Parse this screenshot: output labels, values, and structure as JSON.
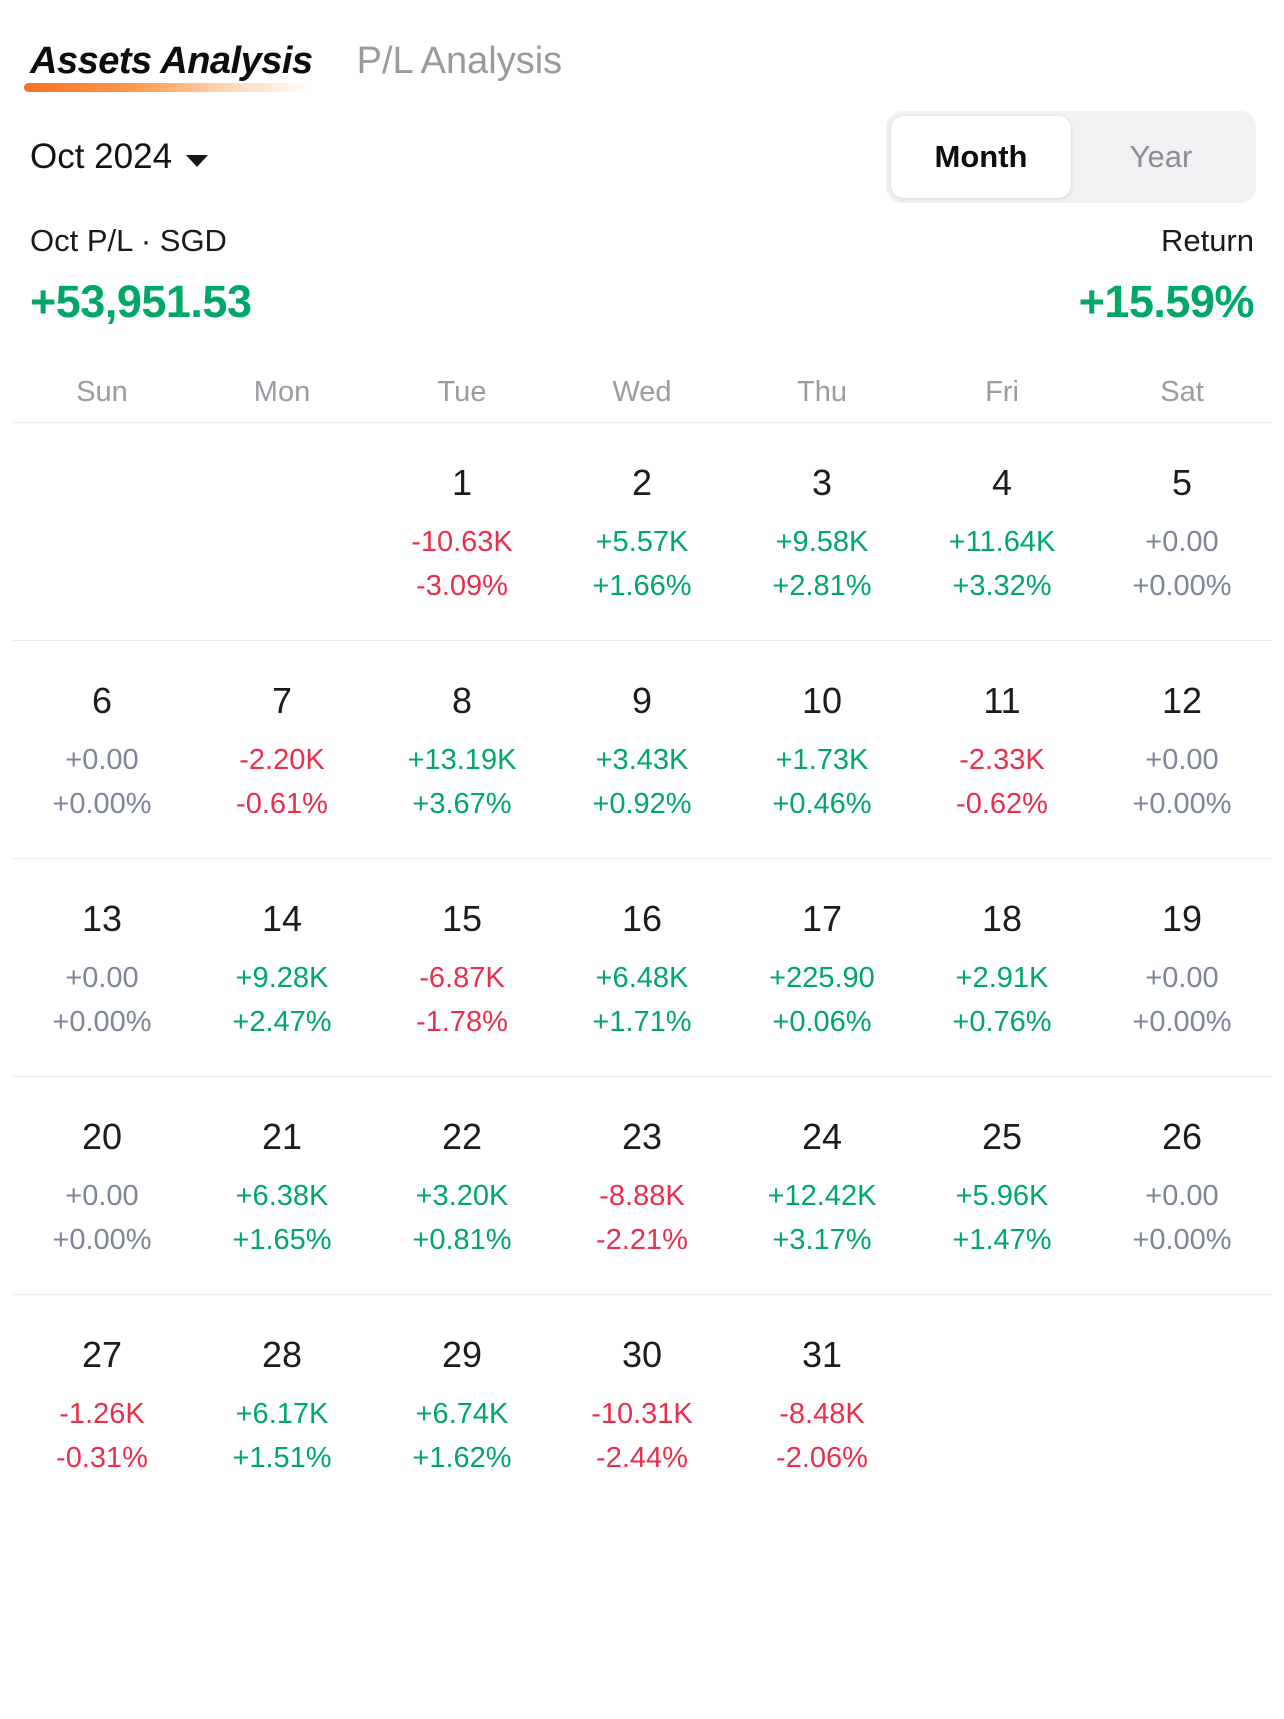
{
  "tabs": [
    {
      "label": "Assets Analysis",
      "active": true
    },
    {
      "label": "P/L Analysis",
      "active": false
    }
  ],
  "period_selector": {
    "label": "Oct 2024",
    "caret_icon": "chevron-down-icon"
  },
  "range_toggle": {
    "options": [
      {
        "label": "Month",
        "active": true
      },
      {
        "label": "Year",
        "active": false
      }
    ]
  },
  "summary": {
    "pl_label": "Oct P/L · SGD",
    "pl_value": "+53,951.53",
    "pl_state": "pos",
    "return_label": "Return",
    "return_value": "+15.59%",
    "return_state": "pos"
  },
  "colors": {
    "positive": "#00a868",
    "negative": "#eb2f4b",
    "zero": "#7d8697",
    "accent": "#f77122",
    "text": "#1c1c20",
    "muted": "#9b9ba2"
  },
  "calendar": {
    "weekdays": [
      "Sun",
      "Mon",
      "Tue",
      "Wed",
      "Thu",
      "Fri",
      "Sat"
    ],
    "weeks": [
      [
        {
          "empty": true
        },
        {
          "empty": true
        },
        {
          "day": "1",
          "amount": "-10.63K",
          "percent": "-3.09%",
          "state": "neg"
        },
        {
          "day": "2",
          "amount": "+5.57K",
          "percent": "+1.66%",
          "state": "pos"
        },
        {
          "day": "3",
          "amount": "+9.58K",
          "percent": "+2.81%",
          "state": "pos"
        },
        {
          "day": "4",
          "amount": "+11.64K",
          "percent": "+3.32%",
          "state": "pos"
        },
        {
          "day": "5",
          "amount": "+0.00",
          "percent": "+0.00%",
          "state": "zero"
        }
      ],
      [
        {
          "day": "6",
          "amount": "+0.00",
          "percent": "+0.00%",
          "state": "zero"
        },
        {
          "day": "7",
          "amount": "-2.20K",
          "percent": "-0.61%",
          "state": "neg"
        },
        {
          "day": "8",
          "amount": "+13.19K",
          "percent": "+3.67%",
          "state": "pos"
        },
        {
          "day": "9",
          "amount": "+3.43K",
          "percent": "+0.92%",
          "state": "pos"
        },
        {
          "day": "10",
          "amount": "+1.73K",
          "percent": "+0.46%",
          "state": "pos"
        },
        {
          "day": "11",
          "amount": "-2.33K",
          "percent": "-0.62%",
          "state": "neg"
        },
        {
          "day": "12",
          "amount": "+0.00",
          "percent": "+0.00%",
          "state": "zero"
        }
      ],
      [
        {
          "day": "13",
          "amount": "+0.00",
          "percent": "+0.00%",
          "state": "zero"
        },
        {
          "day": "14",
          "amount": "+9.28K",
          "percent": "+2.47%",
          "state": "pos"
        },
        {
          "day": "15",
          "amount": "-6.87K",
          "percent": "-1.78%",
          "state": "neg"
        },
        {
          "day": "16",
          "amount": "+6.48K",
          "percent": "+1.71%",
          "state": "pos"
        },
        {
          "day": "17",
          "amount": "+225.90",
          "percent": "+0.06%",
          "state": "pos"
        },
        {
          "day": "18",
          "amount": "+2.91K",
          "percent": "+0.76%",
          "state": "pos"
        },
        {
          "day": "19",
          "amount": "+0.00",
          "percent": "+0.00%",
          "state": "zero"
        }
      ],
      [
        {
          "day": "20",
          "amount": "+0.00",
          "percent": "+0.00%",
          "state": "zero"
        },
        {
          "day": "21",
          "amount": "+6.38K",
          "percent": "+1.65%",
          "state": "pos"
        },
        {
          "day": "22",
          "amount": "+3.20K",
          "percent": "+0.81%",
          "state": "pos"
        },
        {
          "day": "23",
          "amount": "-8.88K",
          "percent": "-2.21%",
          "state": "neg"
        },
        {
          "day": "24",
          "amount": "+12.42K",
          "percent": "+3.17%",
          "state": "pos"
        },
        {
          "day": "25",
          "amount": "+5.96K",
          "percent": "+1.47%",
          "state": "pos"
        },
        {
          "day": "26",
          "amount": "+0.00",
          "percent": "+0.00%",
          "state": "zero"
        }
      ],
      [
        {
          "day": "27",
          "amount": "-1.26K",
          "percent": "-0.31%",
          "state": "neg"
        },
        {
          "day": "28",
          "amount": "+6.17K",
          "percent": "+1.51%",
          "state": "pos"
        },
        {
          "day": "29",
          "amount": "+6.74K",
          "percent": "+1.62%",
          "state": "pos"
        },
        {
          "day": "30",
          "amount": "-10.31K",
          "percent": "-2.44%",
          "state": "neg"
        },
        {
          "day": "31",
          "amount": "-8.48K",
          "percent": "-2.06%",
          "state": "neg"
        },
        {
          "empty": true
        },
        {
          "empty": true
        }
      ]
    ]
  }
}
